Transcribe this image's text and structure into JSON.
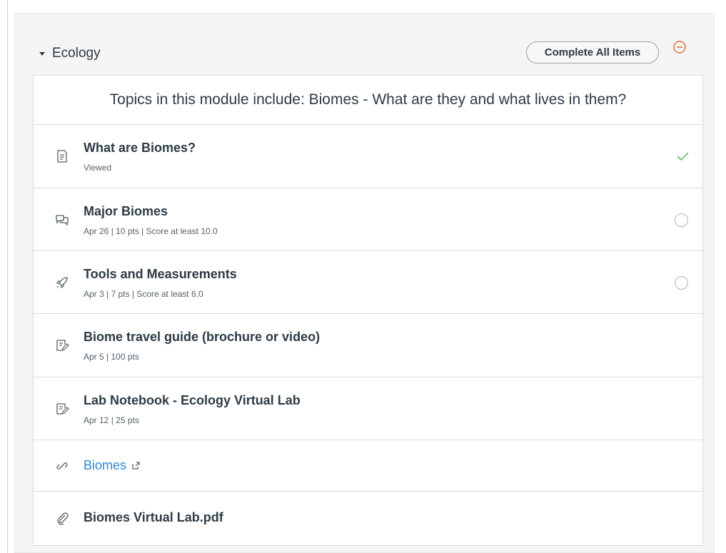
{
  "module": {
    "title": "Ecology",
    "complete_all_label": "Complete All Items",
    "description": "Topics in this module include: Biomes - What are they and what lives in them?",
    "items": [
      {
        "title": "What are Biomes?",
        "meta": "Viewed",
        "icon": "page-icon",
        "status": "completed"
      },
      {
        "title": "Major Biomes",
        "meta": "Apr 26  |  10 pts  |  Score at least 10.0",
        "icon": "discussion-icon",
        "status": "incomplete"
      },
      {
        "title": "Tools and Measurements",
        "meta": "Apr 3  |  7 pts  |  Score at least 6.0",
        "icon": "quiz-rocket-icon",
        "status": "incomplete"
      },
      {
        "title": "Biome travel guide (brochure or video)",
        "meta": "Apr 5  |  100 pts",
        "icon": "assignment-icon",
        "status": "none"
      },
      {
        "title": "Lab Notebook - Ecology Virtual Lab",
        "meta": "Apr 12  |  25 pts",
        "icon": "assignment-icon",
        "status": "none"
      },
      {
        "title": "Biomes",
        "meta": "",
        "icon": "link-icon",
        "status": "none"
      },
      {
        "title": "Biomes Virtual Lab.pdf",
        "meta": "",
        "icon": "attachment-icon",
        "status": "none"
      }
    ]
  },
  "colors": {
    "text": "#2d3b45",
    "link": "#2a8bd5",
    "success": "#5ab55a",
    "remove": "#e0723a"
  }
}
